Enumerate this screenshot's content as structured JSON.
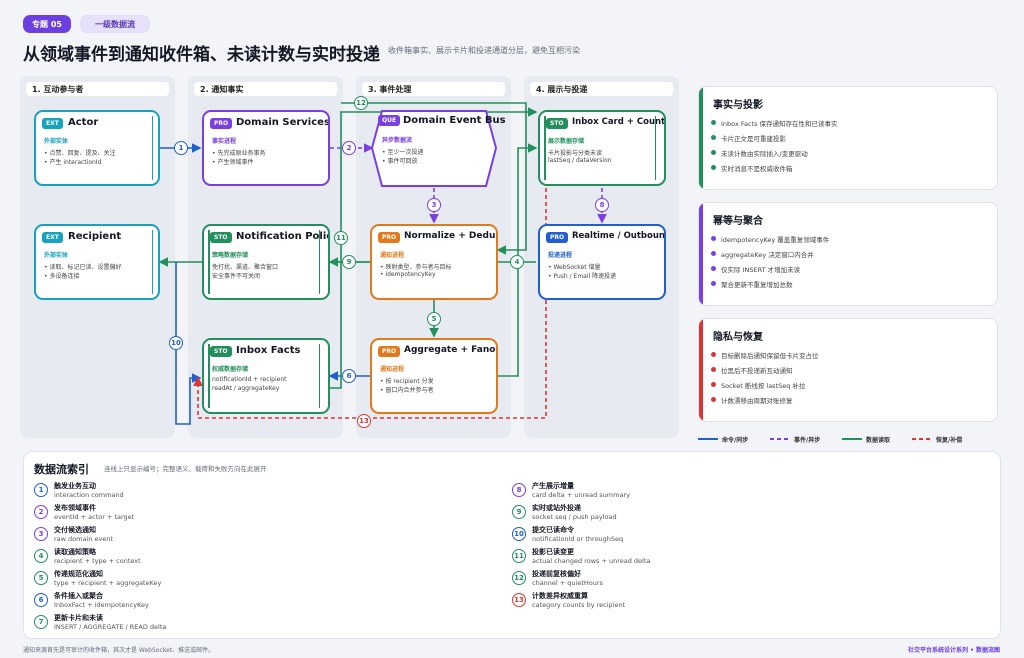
{
  "header": {
    "topic_pill": "专题 05",
    "category_pill": "一级数据流",
    "title": "从领域事件到通知收件箱、未读计数与实时投递",
    "subtitle": "收件箱事实、展示卡片和投递通道分层，避免互相污染"
  },
  "lanes": [
    {
      "label": "1. 互动参与者"
    },
    {
      "label": "2. 通知事实"
    },
    {
      "label": "3. 事件处理"
    },
    {
      "label": "4. 展示与投递"
    }
  ],
  "nodes": {
    "actor": {
      "tag": "EXT",
      "title": "Actor",
      "sub": "外部实体",
      "lines": [
        "• 点赞、回复、提及、关注",
        "• 产生 interactionId"
      ]
    },
    "recipient": {
      "tag": "EXT",
      "title": "Recipient",
      "sub": "外部实体",
      "lines": [
        "• 读取、标记已读、设置偏好",
        "• 多设备连接"
      ]
    },
    "domain_services": {
      "tag": "PRO",
      "title": "Domain Services",
      "sub": "事实进程",
      "lines": [
        "• 先完成原业务事务",
        "• 产生领域事件"
      ]
    },
    "notification_policy": {
      "tag": "STO",
      "title": "Notification Policy",
      "sub": "策略数据存储",
      "lines": [
        "免打扰、渠道、聚合窗口",
        "安全事件不可关闭"
      ]
    },
    "inbox_facts": {
      "tag": "STO",
      "title": "Inbox Facts",
      "sub": "权威数据存储",
      "lines": [
        "notificationId + recipient",
        "readAt / aggregateKey"
      ]
    },
    "event_bus": {
      "tag": "QUE",
      "title": "Domain Event Bus",
      "sub": "异步数据流",
      "lines": [
        "• 至少一次投递",
        "• 事件可回放"
      ]
    },
    "normalize": {
      "tag": "PRO",
      "title": "Normalize + Dedup",
      "sub": "通知进程",
      "lines": [
        "• 映射类型、参与者与目标",
        "• idempotencyKey"
      ]
    },
    "aggregate": {
      "tag": "PRO",
      "title": "Aggregate + Fanout",
      "sub": "通知进程",
      "lines": [
        "• 按 recipient 分发",
        "• 窗口内合并参与者"
      ]
    },
    "inbox_card": {
      "tag": "STO",
      "title": "Inbox Card + Counter",
      "sub": "展示数据存储",
      "lines": [
        "卡片投影与分类未读",
        "lastSeq / dataVersion"
      ]
    },
    "realtime": {
      "tag": "PRO",
      "title": "Realtime / Outbound",
      "sub": "投递进程",
      "lines": [
        "• WebSocket 增量",
        "• Push / Email 降速投递"
      ]
    }
  },
  "badges": [
    "1",
    "2",
    "3",
    "4",
    "5",
    "6",
    "7",
    "8",
    "9",
    "10",
    "11",
    "12",
    "13"
  ],
  "side_panels": [
    {
      "title": "事实与投影",
      "color": "#22905c",
      "items": [
        "Inbox Facts 保存通知存在性和已读事实",
        "卡片正文是可重建投影",
        "未读计数由实际插入/变更驱动",
        "实时消息不是权威收件箱"
      ]
    },
    {
      "title": "幂等与聚合",
      "color": "#7a3fe0",
      "items": [
        "idempotencyKey 覆盖重复领域事件",
        "aggregateKey 决定窗口内合并",
        "仅实际 INSERT 才增加未读",
        "聚合更新不重复增加总数"
      ]
    },
    {
      "title": "隐私与恢复",
      "color": "#d93636",
      "items": [
        "目标删除后通知保留但卡片变占位",
        "拉黑后不投递新互动通知",
        "Socket 断线按 lastSeq 补拉",
        "计数漂移由周期对账修复"
      ]
    }
  ],
  "legend": [
    {
      "label": "命令/同步",
      "color": "#1f5fd0",
      "style": "solid"
    },
    {
      "label": "事件/异步",
      "color": "#7a3fe0",
      "style": "dashed"
    },
    {
      "label": "数据读取",
      "color": "#22905c",
      "style": "solid"
    },
    {
      "label": "恢复/补偿",
      "color": "#d93636",
      "style": "dashed"
    }
  ],
  "index": {
    "title": "数据流索引",
    "subtitle": "连线上只显示编号；完整语义、载荷和失败方向在此展开",
    "left": [
      {
        "n": "1",
        "color": "#1f5fd0",
        "title": "触发业务互动",
        "desc": "interaction command"
      },
      {
        "n": "2",
        "color": "#7a3fe0",
        "title": "发布领域事件",
        "desc": "eventId + actor + target"
      },
      {
        "n": "3",
        "color": "#7a3fe0",
        "title": "交付候选通知",
        "desc": "raw domain event"
      },
      {
        "n": "4",
        "color": "#22905c",
        "title": "读取通知策略",
        "desc": "recipient + type + context"
      },
      {
        "n": "5",
        "color": "#22905c",
        "title": "传递规范化通知",
        "desc": "type + recipient + aggregateKey"
      },
      {
        "n": "6",
        "color": "#1f5fd0",
        "title": "条件插入或聚合",
        "desc": "InboxFact + idempotencyKey"
      },
      {
        "n": "7",
        "color": "#22905c",
        "title": "更新卡片和未读",
        "desc": "INSERT / AGGREGATE / READ delta"
      }
    ],
    "right": [
      {
        "n": "8",
        "color": "#7a3fe0",
        "title": "产生展示增量",
        "desc": "card delta + unread summary"
      },
      {
        "n": "9",
        "color": "#22905c",
        "title": "实时或站外投递",
        "desc": "socket seq / push payload"
      },
      {
        "n": "10",
        "color": "#1f5fd0",
        "title": "提交已读命令",
        "desc": "notificationId or throughSeq"
      },
      {
        "n": "11",
        "color": "#22905c",
        "title": "投影已读变更",
        "desc": "actual changed rows + unread delta"
      },
      {
        "n": "12",
        "color": "#22905c",
        "title": "投递前复核偏好",
        "desc": "channel + quietHours"
      },
      {
        "n": "13",
        "color": "#d93636",
        "title": "计数差异权威重算",
        "desc": "category counts by recipient"
      }
    ]
  },
  "footer": {
    "left": "通知来源首先是可审计的收件箱，其次才是 WebSocket、推送或邮件。",
    "right": "社交平台系统设计系列 • 数据流图"
  }
}
